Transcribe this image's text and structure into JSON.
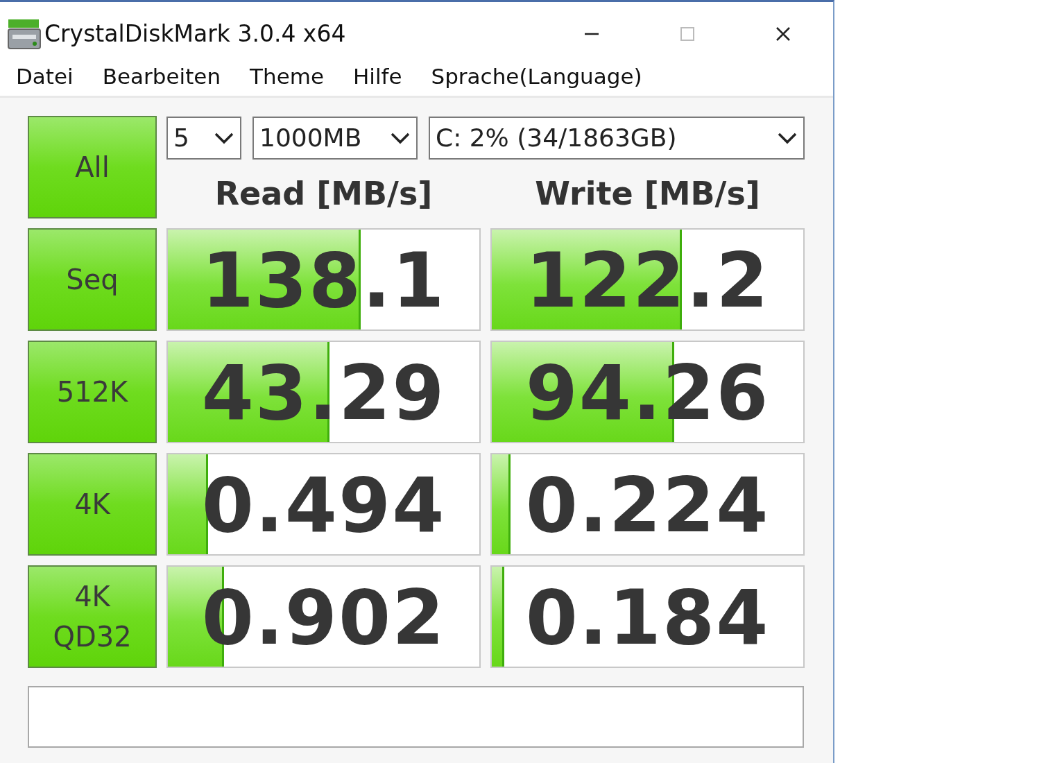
{
  "window": {
    "title": "CrystalDiskMark 3.0.4 x64"
  },
  "menu": [
    "Datei",
    "Bearbeiten",
    "Theme",
    "Hilfe",
    "Sprache(Language)"
  ],
  "controls": {
    "all_button": "All",
    "count": "5",
    "size": "1000MB",
    "drive": "C: 2% (34/1863GB)"
  },
  "headers": [
    "Read [MB/s]",
    "Write [MB/s]"
  ],
  "rows": [
    {
      "label": "Seq",
      "read": {
        "value": "138.1",
        "level": 0.62
      },
      "write": {
        "value": "122.2",
        "level": 0.61
      }
    },
    {
      "label": "512K",
      "read": {
        "value": "43.29",
        "level": 0.52
      },
      "write": {
        "value": "94.26",
        "level": 0.585
      }
    },
    {
      "label": "4K",
      "read": {
        "value": "0.494",
        "level": 0.13
      },
      "write": {
        "value": "0.224",
        "level": 0.06
      }
    },
    {
      "label": "4K\nQD32",
      "read": {
        "value": "0.902",
        "level": 0.18
      },
      "write": {
        "value": "0.184",
        "level": 0.04
      }
    }
  ]
}
